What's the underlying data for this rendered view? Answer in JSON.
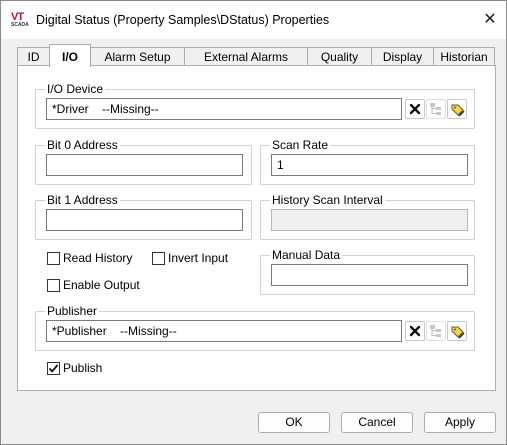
{
  "window": {
    "title": "Digital Status (Property Samples\\DStatus) Properties",
    "app_icon_text": "VT",
    "app_icon_subtext": "SCADA"
  },
  "tabs": [
    {
      "label": "ID",
      "active": false
    },
    {
      "label": "I/O",
      "active": true
    },
    {
      "label": "Alarm Setup",
      "active": false
    },
    {
      "label": "External Alarms",
      "active": false
    },
    {
      "label": "Quality",
      "active": false
    },
    {
      "label": "Display",
      "active": false
    },
    {
      "label": "Historian",
      "active": false
    }
  ],
  "io_device": {
    "legend": "I/O Device",
    "value": "*Driver    --Missing--"
  },
  "bit0": {
    "legend": "Bit 0 Address",
    "value": ""
  },
  "bit1": {
    "legend": "Bit 1 Address",
    "value": ""
  },
  "scan_rate": {
    "legend": "Scan Rate",
    "value": "1"
  },
  "history_scan": {
    "legend": "History Scan Interval",
    "value": ""
  },
  "manual_data": {
    "legend": "Manual Data",
    "value": ""
  },
  "options": {
    "read_history": {
      "label": "Read History",
      "checked": false
    },
    "invert_input": {
      "label": "Invert Input",
      "checked": false
    },
    "enable_output": {
      "label": "Enable Output",
      "checked": false
    }
  },
  "publisher": {
    "legend": "Publisher",
    "value": "*Publisher    --Missing--"
  },
  "publish": {
    "label": "Publish",
    "checked": true
  },
  "buttons": {
    "ok": "OK",
    "cancel": "Cancel",
    "apply": "Apply"
  }
}
